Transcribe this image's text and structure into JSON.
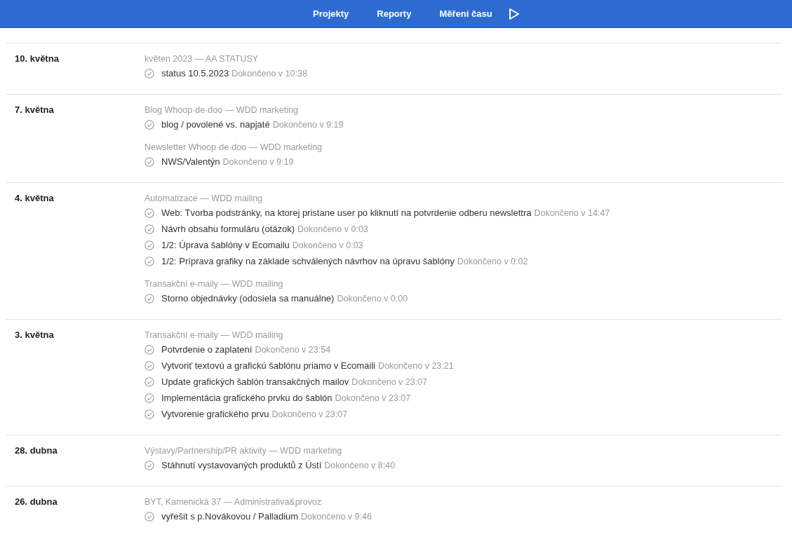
{
  "nav": {
    "items": [
      {
        "label": "Projekty"
      },
      {
        "label": "Reporty"
      },
      {
        "label": "Měření času"
      }
    ]
  },
  "days": [
    {
      "date": "10. května",
      "groups": [
        {
          "project": "květen 2023 — AA STATUSY",
          "tasks": [
            {
              "title": "status 10.5.2023",
              "meta": "Dokončeno v 10:38"
            }
          ]
        }
      ]
    },
    {
      "date": "7. května",
      "groups": [
        {
          "project": "Blog Whoop·de·doo — WDD marketing",
          "tasks": [
            {
              "title": "blog / povolené vs. napjaté",
              "meta": "Dokončeno v 9:19"
            }
          ]
        },
        {
          "project": "Newsletter Whoop·de·doo — WDD marketing",
          "tasks": [
            {
              "title": "NWS/Valentýn",
              "meta": "Dokončeno v 9:19"
            }
          ]
        }
      ]
    },
    {
      "date": "4. května",
      "groups": [
        {
          "project": "Automatizace — WDD mailing",
          "tasks": [
            {
              "title": "Web: Tvorba podstránky, na ktorej pristane user po kliknutí na potvrdenie odberu newslettra",
              "meta": "Dokončeno v 14:47"
            },
            {
              "title": "Návrh obsahu formuláru (otázok)",
              "meta": "Dokončeno v 0:03"
            },
            {
              "title": "1/2: Úprava šablóny v Ecomailu",
              "meta": "Dokončeno v 0:03"
            },
            {
              "title": "1/2: Príprava grafiky na základe schválených návrhov na úpravu šablóny",
              "meta": "Dokončeno v 0:02"
            }
          ]
        },
        {
          "project": "Transakční e-maily — WDD mailing",
          "tasks": [
            {
              "title": "Storno objednávky (odosiela sa manuálne)",
              "meta": "Dokončeno v 0:00"
            }
          ]
        }
      ]
    },
    {
      "date": "3. května",
      "groups": [
        {
          "project": "Transakční e-maily — WDD mailing",
          "tasks": [
            {
              "title": "Potvrdenie o zaplatení",
              "meta": "Dokončeno v 23:54"
            },
            {
              "title": "Vytvoriť textovú a grafickú šablónu priamo v Ecomaili",
              "meta": "Dokončeno v 23:21"
            },
            {
              "title": "Update grafických šablón transakčných mailov",
              "meta": "Dokončeno v 23:07"
            },
            {
              "title": "Implementácia grafického prvku do šablón",
              "meta": "Dokončeno v 23:07"
            },
            {
              "title": "Vytvorenie grafického prvu",
              "meta": "Dokončeno v 23:07"
            }
          ]
        }
      ]
    },
    {
      "date": "28. dubna",
      "groups": [
        {
          "project": "Výstavy/Partnership/PR aktivity — WDD marketing",
          "tasks": [
            {
              "title": "Stáhnutí vystavovaných produktů z Ústí",
              "meta": "Dokončeno v 8:40"
            }
          ]
        }
      ]
    },
    {
      "date": "26. dubna",
      "groups": [
        {
          "project": "BYT, Kamenická 37 — Administrativa&provoz",
          "tasks": [
            {
              "title": "vyřešit s p.Novákovou / Palladium",
              "meta": "Dokončeno v 9:46"
            }
          ]
        }
      ]
    }
  ]
}
